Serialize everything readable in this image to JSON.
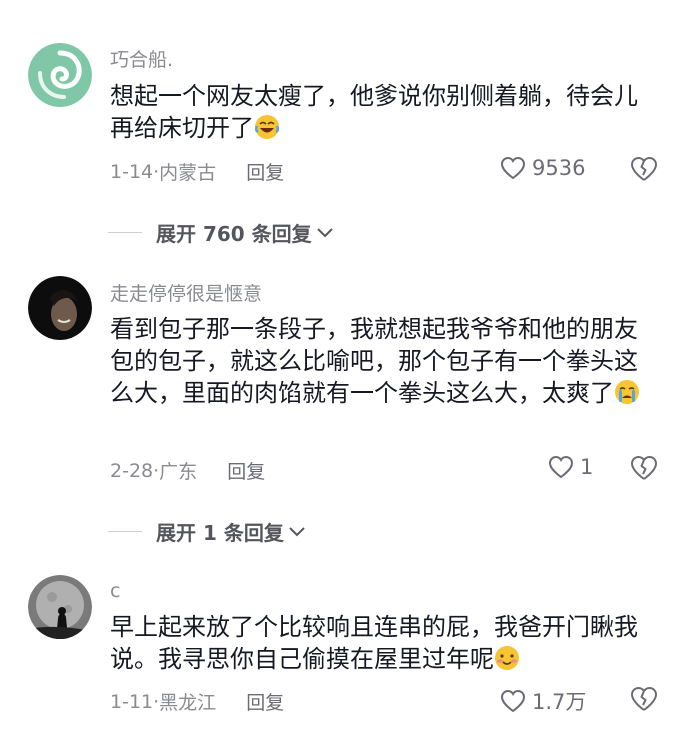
{
  "comments": [
    {
      "username": "巧合船.",
      "text": "想起一个网友太瘦了，他爹说你别侧着躺，待会儿再给床切开了",
      "date": "1-14",
      "location": "内蒙古",
      "reply_label": "回复",
      "likes": "9536",
      "expand_label": "展开 760 条回复",
      "emoji": "laughing-tears-emoji"
    },
    {
      "username": "走走停停很是惬意",
      "text": "看到包子那一条段子，我就想起我爷爷和他的朋友包的包子，就这么比喻吧，那个包子有一个拳头这么大，里面的肉馅就有一个拳头这么大，太爽了",
      "date": "2-28",
      "location": "广东",
      "reply_label": "回复",
      "likes": "1",
      "expand_label": "展开 1 条回复",
      "emoji": "crying-emoji"
    },
    {
      "username": "c",
      "text": "早上起来放了个比较响且连串的屁，我爸开门瞅我说。我寻思你自己偷摸在屋里过年呢",
      "date": "1-11",
      "location": "黑龙江",
      "reply_label": "回复",
      "likes": "1.7万",
      "emoji": "shy-smile-emoji"
    }
  ],
  "colors": {
    "text": "#161823",
    "secondary": "#8a8b91",
    "emoji": "#f7c531"
  }
}
